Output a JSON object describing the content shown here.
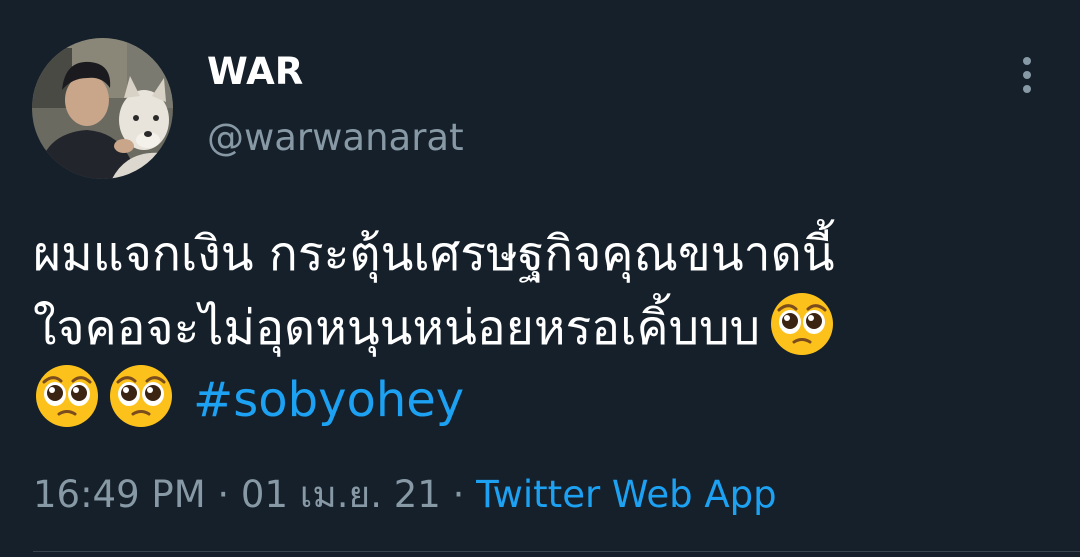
{
  "author": {
    "display_name": "WAR",
    "handle": "@warwanarat"
  },
  "tweet": {
    "line1": "ผมแจกเงิน กระตุ้นเศรษฐกิจคุณขนาดนี้",
    "line2": "ใจคอจะไม่อุดหนุนหน่อยหรอเคิ้บบบ",
    "emoji_icon": "pleading-face-icon",
    "hashtag": "#sobyohey"
  },
  "meta": {
    "time": "16:49 PM",
    "separator": " · ",
    "date": "01 เม.ย. 21",
    "source": "Twitter Web App"
  },
  "colors": {
    "background": "#15202b",
    "text": "#ffffff",
    "secondary": "#8899a6",
    "link": "#1da1f2",
    "divider": "#38444d"
  }
}
